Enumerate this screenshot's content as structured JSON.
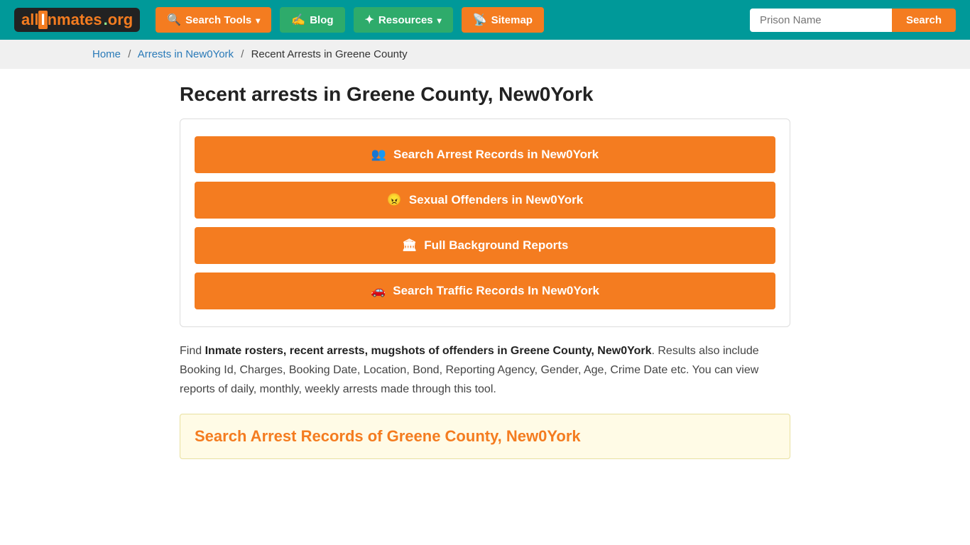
{
  "header": {
    "logo": "allInmates.org",
    "logo_display": "all🔒nmates.org",
    "nav": [
      {
        "label": "Search Tools",
        "type": "dropdown",
        "icon": "search-icon"
      },
      {
        "label": "Blog",
        "type": "link",
        "icon": "blog-icon"
      },
      {
        "label": "Resources",
        "type": "dropdown",
        "icon": "resources-icon"
      },
      {
        "label": "Sitemap",
        "type": "link",
        "icon": "rss-icon"
      }
    ],
    "search_placeholder": "Prison Name",
    "search_button": "Search"
  },
  "breadcrumb": {
    "items": [
      {
        "label": "Home",
        "href": "#"
      },
      {
        "label": "Arrests in New0York",
        "href": "#"
      },
      {
        "label": "Recent Arrests in Greene County",
        "href": null
      }
    ]
  },
  "main": {
    "page_title": "Recent arrests in Greene County, New0York",
    "action_buttons": [
      {
        "label": "Search Arrest Records in New0York",
        "icon": "users-icon"
      },
      {
        "label": "Sexual Offenders in New0York",
        "icon": "offender-icon"
      },
      {
        "label": "Full Background Reports",
        "icon": "report-icon"
      },
      {
        "label": "Search Traffic Records In New0York",
        "icon": "car-icon"
      }
    ],
    "description_part1": "Find ",
    "description_bold1": "Inmate rosters, recent arrests, mugshots of offenders in Greene County, New0York",
    "description_part2": ". Results also include Booking Id, Charges, Booking Date, Location, Bond, Reporting Agency, Gender, Age, Crime Date etc. You can view reports of daily, monthly, weekly arrests made through this tool.",
    "search_section_title": "Search Arrest Records of Greene County, New0York"
  }
}
